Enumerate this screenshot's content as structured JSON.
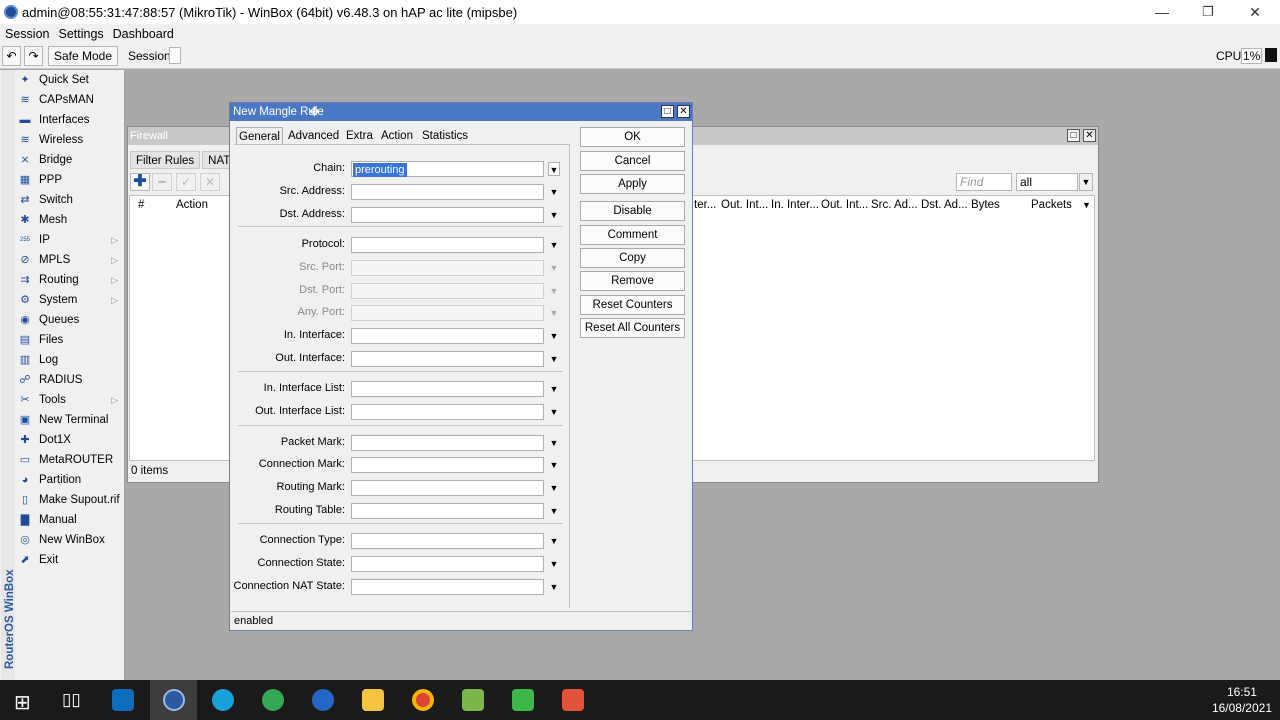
{
  "window": {
    "title": "admin@08:55:31:47:88:57 (MikroTik) - WinBox (64bit) v6.48.3 on hAP ac lite (mipsbe)",
    "minimize": "—",
    "restore": "❐",
    "close": "✕"
  },
  "menubar": {
    "items": [
      "Session",
      "Settings",
      "Dashboard"
    ]
  },
  "toolbar": {
    "undo": "↶",
    "redo": "↷",
    "safe_mode": "Safe Mode",
    "session_label": "Session:",
    "cpu_label": "CPU:",
    "cpu_value": "1%"
  },
  "sidebar": {
    "brand": "RouterOS WinBox",
    "items": [
      {
        "label": "Quick Set",
        "icon": "quick-set-icon",
        "glyph": "✦",
        "submenu": false
      },
      {
        "label": "CAPsMAN",
        "icon": "capsman-icon",
        "glyph": "≋",
        "submenu": false
      },
      {
        "label": "Interfaces",
        "icon": "interfaces-icon",
        "glyph": "▬",
        "submenu": false
      },
      {
        "label": "Wireless",
        "icon": "wireless-icon",
        "glyph": "≋",
        "submenu": false
      },
      {
        "label": "Bridge",
        "icon": "bridge-icon",
        "glyph": "⨯",
        "submenu": false
      },
      {
        "label": "PPP",
        "icon": "ppp-icon",
        "glyph": "▦",
        "submenu": false
      },
      {
        "label": "Switch",
        "icon": "switch-icon",
        "glyph": "⇄",
        "submenu": false
      },
      {
        "label": "Mesh",
        "icon": "mesh-icon",
        "glyph": "✱",
        "submenu": false
      },
      {
        "label": "IP",
        "icon": "ip-icon",
        "glyph": "255",
        "submenu": true
      },
      {
        "label": "MPLS",
        "icon": "mpls-icon",
        "glyph": "⊘",
        "submenu": true
      },
      {
        "label": "Routing",
        "icon": "routing-icon",
        "glyph": "⇉",
        "submenu": true
      },
      {
        "label": "System",
        "icon": "system-icon",
        "glyph": "⚙",
        "submenu": true
      },
      {
        "label": "Queues",
        "icon": "queues-icon",
        "glyph": "◉",
        "submenu": false
      },
      {
        "label": "Files",
        "icon": "files-icon",
        "glyph": "▤",
        "submenu": false
      },
      {
        "label": "Log",
        "icon": "log-icon",
        "glyph": "▥",
        "submenu": false
      },
      {
        "label": "RADIUS",
        "icon": "radius-icon",
        "glyph": "☍",
        "submenu": false
      },
      {
        "label": "Tools",
        "icon": "tools-icon",
        "glyph": "✂",
        "submenu": true
      },
      {
        "label": "New Terminal",
        "icon": "terminal-icon",
        "glyph": "▣",
        "submenu": false
      },
      {
        "label": "Dot1X",
        "icon": "dot1x-icon",
        "glyph": "✚",
        "submenu": false
      },
      {
        "label": "MetaROUTER",
        "icon": "metarouter-icon",
        "glyph": "▭",
        "submenu": false
      },
      {
        "label": "Partition",
        "icon": "partition-icon",
        "glyph": "◕",
        "submenu": false
      },
      {
        "label": "Make Supout.rif",
        "icon": "supout-icon",
        "glyph": "▯",
        "submenu": false
      },
      {
        "label": "Manual",
        "icon": "manual-icon",
        "glyph": "▇",
        "submenu": false
      },
      {
        "label": "New WinBox",
        "icon": "winbox-icon",
        "glyph": "◎",
        "submenu": false
      },
      {
        "label": "Exit",
        "icon": "exit-icon",
        "glyph": "⬈",
        "submenu": false
      }
    ]
  },
  "firewall": {
    "title": "Firewall",
    "tabs": [
      "Filter Rules",
      "NAT"
    ],
    "find_placeholder": "Find",
    "filter_value": "all",
    "columns_left": [
      "#",
      "Action"
    ],
    "columns_right": [
      "ter...",
      "Out. Int...",
      "In. Inter...",
      "Out. Int...",
      "Src. Ad...",
      "Dst. Ad...",
      "Bytes",
      "Packets"
    ],
    "status": "0 items"
  },
  "dialog": {
    "title": "New Mangle Rule",
    "tabs": [
      "General",
      "Advanced",
      "Extra",
      "Action",
      "Statistics"
    ],
    "fields": [
      {
        "label": "Chain:",
        "value": "prerouting",
        "disabled": false
      },
      {
        "label": "Src. Address:",
        "value": "",
        "disabled": false
      },
      {
        "label": "Dst. Address:",
        "value": "",
        "disabled": false
      },
      {
        "label": "Protocol:",
        "value": "",
        "disabled": false
      },
      {
        "label": "Src. Port:",
        "value": "",
        "disabled": true
      },
      {
        "label": "Dst. Port:",
        "value": "",
        "disabled": true
      },
      {
        "label": "Any. Port:",
        "value": "",
        "disabled": true
      },
      {
        "label": "In. Interface:",
        "value": "",
        "disabled": false
      },
      {
        "label": "Out. Interface:",
        "value": "",
        "disabled": false
      },
      {
        "label": "In. Interface List:",
        "value": "",
        "disabled": false
      },
      {
        "label": "Out. Interface List:",
        "value": "",
        "disabled": false
      },
      {
        "label": "Packet Mark:",
        "value": "",
        "disabled": false
      },
      {
        "label": "Connection Mark:",
        "value": "",
        "disabled": false
      },
      {
        "label": "Routing Mark:",
        "value": "",
        "disabled": false
      },
      {
        "label": "Routing Table:",
        "value": "",
        "disabled": false
      },
      {
        "label": "Connection Type:",
        "value": "",
        "disabled": false
      },
      {
        "label": "Connection State:",
        "value": "",
        "disabled": false
      },
      {
        "label": "Connection NAT State:",
        "value": "",
        "disabled": false
      }
    ],
    "buttons": [
      "OK",
      "Cancel",
      "Apply",
      "Disable",
      "Comment",
      "Copy",
      "Remove",
      "Reset Counters",
      "Reset All Counters"
    ],
    "status": "enabled"
  },
  "taskbar": {
    "time": "16:51",
    "date": "16/08/2021",
    "apps": [
      "start-icon",
      "task-view-icon",
      "outlook-icon",
      "winbox-app-icon",
      "edge-icon",
      "chat-icon",
      "edge-dev-icon",
      "file-explorer-icon",
      "chrome-icon",
      "notepad-icon",
      "camtasia-green-icon",
      "camtasia-red-icon"
    ]
  }
}
